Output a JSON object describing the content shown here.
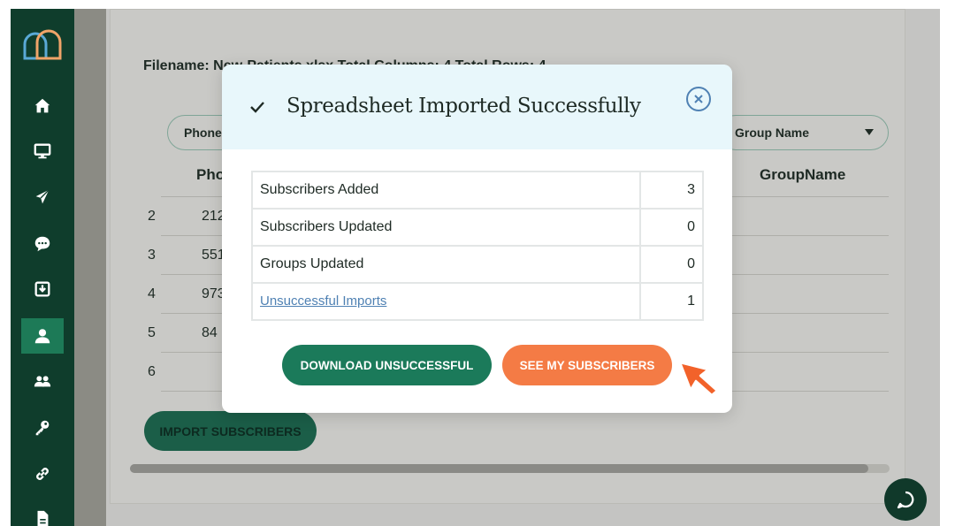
{
  "sidebar": {
    "items": [
      {
        "icon": "home-icon"
      },
      {
        "icon": "monitor-icon"
      },
      {
        "icon": "send-icon"
      },
      {
        "icon": "chat-bubble-icon"
      },
      {
        "icon": "inbox-download-icon"
      },
      {
        "icon": "user-icon",
        "active": true
      },
      {
        "icon": "users-group-icon"
      },
      {
        "icon": "key-icon"
      },
      {
        "icon": "link-icon"
      },
      {
        "icon": "document-icon"
      }
    ]
  },
  "background": {
    "filename_line": "Filename: New-Patients.xlsx  Total Columns: 4  Total Rows: 4",
    "map_select_phone": "Phone",
    "map_select_group": "Group Name",
    "columns": [
      "Pho",
      "GroupName"
    ],
    "rows": [
      {
        "num": "2",
        "phone": "212"
      },
      {
        "num": "3",
        "phone": "551"
      },
      {
        "num": "4",
        "phone": "973"
      },
      {
        "num": "5",
        "phone": "84"
      },
      {
        "num": "6",
        "phone": ""
      }
    ],
    "import_button": "IMPORT SUBSCRIBERS"
  },
  "modal": {
    "title": "Spreadsheet Imported Successfully",
    "stats": [
      {
        "label": "Subscribers Added",
        "value": "3",
        "link": false
      },
      {
        "label": "Subscribers Updated",
        "value": "0",
        "link": false
      },
      {
        "label": "Groups Updated",
        "value": "0",
        "link": false
      },
      {
        "label": "Unsuccessful Imports",
        "value": "1",
        "link": true
      }
    ],
    "download_button": "DOWNLOAD UNSUCCESSFUL",
    "see_button": "SEE MY SUBSCRIBERS"
  },
  "colors": {
    "sidebar": "#0f3d2c",
    "primary_green": "#1b7a5a",
    "accent_orange": "#f47b45",
    "link_blue": "#4f81b3",
    "modal_header": "#e8f7fb"
  }
}
